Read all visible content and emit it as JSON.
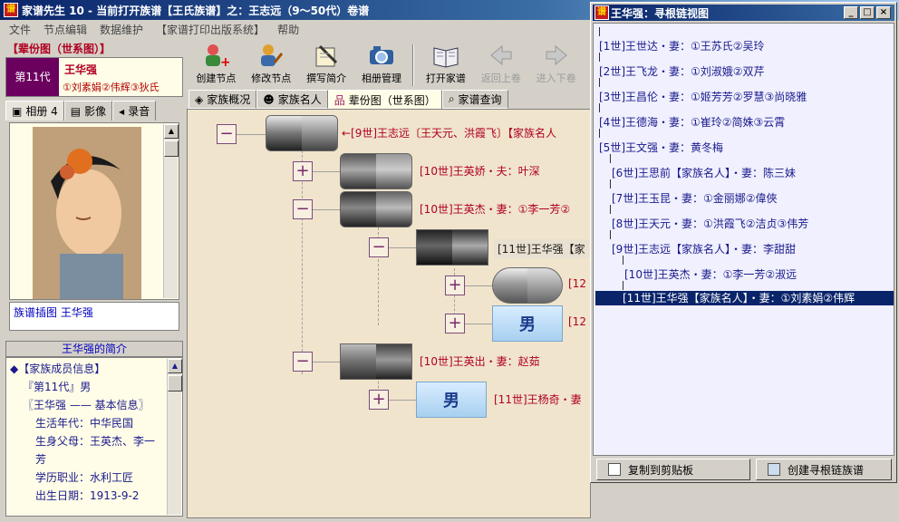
{
  "app": {
    "title": "家谱先生 10 - 当前打开族谱【王氏族谱】之：王志远（9～50代）卷谱",
    "menu": [
      "文件",
      "节点编辑",
      "数据维护",
      "【家谱打印出版系统】",
      "帮助"
    ]
  },
  "left": {
    "gen_title": "【辈份图（世系图）】",
    "generation": "第11代",
    "name": "王华强",
    "spouses": "①刘素娟②伟辉③狄氏",
    "tabs": [
      {
        "label": "相册 4",
        "icon": "camera-icon"
      },
      {
        "label": "影像",
        "icon": "video-icon"
      },
      {
        "label": "录音",
        "icon": "audio-icon"
      }
    ],
    "caption": "族谱插图 王华强",
    "intro_title": "王华强的简介",
    "intro_lines": [
      "◆【家族成员信息】",
      "『第11代』男",
      "〖王华强 —— 基本信息〗",
      "生活年代：中华民国",
      "生身父母：王英杰、李一芳",
      "学历职业：水利工匠",
      "出生日期：1913-9-2"
    ]
  },
  "toolbar": {
    "buttons": [
      {
        "label": "创建节点",
        "icon": "create-node-icon",
        "enabled": true
      },
      {
        "label": "修改节点",
        "icon": "edit-node-icon",
        "enabled": true
      },
      {
        "label": "撰写简介",
        "icon": "write-intro-icon",
        "enabled": true
      },
      {
        "label": "相册管理",
        "icon": "album-icon",
        "enabled": true
      },
      {
        "label": "打开家谱",
        "icon": "open-book-icon",
        "enabled": true
      },
      {
        "label": "返回上卷",
        "icon": "arrow-left-icon",
        "enabled": false
      },
      {
        "label": "进入下卷",
        "icon": "arrow-right-icon",
        "enabled": false
      }
    ]
  },
  "view_tabs": [
    {
      "label": "家族概况",
      "icon": "overview-icon"
    },
    {
      "label": "家族名人",
      "icon": "people-icon"
    },
    {
      "label": "辈份图（世系图）",
      "icon": "tree-icon",
      "active": true
    },
    {
      "label": "家谱查询",
      "icon": "search-icon"
    }
  ],
  "tree": {
    "nodes": [
      {
        "text": "←[9世]王志远〔王天元、洪霞飞〕【家族名人",
        "color": "red"
      },
      {
        "text": "[10世]王英娇・夫：叶深",
        "color": "red"
      },
      {
        "text": "[10世]王英杰・妻：①李一芳②",
        "color": "red"
      },
      {
        "text": "[11世]王华强【家",
        "color": "dark"
      },
      {
        "text": "[12",
        "color": "red"
      },
      {
        "text": "[12",
        "color": "red"
      },
      {
        "text": "[10世]王英出・妻：赵茹",
        "color": "red"
      },
      {
        "text": "[11世]王杨奇・妻",
        "color": "red"
      }
    ],
    "male_label": "男"
  },
  "chain_window": {
    "title": "王华强：寻根链视图",
    "items": [
      "[1世]王世达・妻：①王苏氏②吴玲",
      "[2世]王飞龙・妻：①刘淑娥②双芹",
      "[3世]王昌伦・妻：①姬芳芳②罗慧③尚晓雅",
      "[4世]王德海・妻：①崔玲②简姝③云霄",
      "[5世]王文强・妻：黄冬梅",
      "[6世]王思前【家族名人】・妻：陈三妹",
      "[7世]王玉昆・妻：①金丽娜②偉俠",
      "[8世]王天元・妻：①洪霞飞②洁贞③伟芳",
      "[9世]王志远【家族名人】・妻：李甜甜",
      "[10世]王英杰・妻：①李一芳②淑远",
      "[11世]王华强【家族名人】・妻：①刘素娟②伟辉"
    ],
    "copy_btn": "复制到剪贴板",
    "create_btn": "创建寻根链族谱"
  }
}
